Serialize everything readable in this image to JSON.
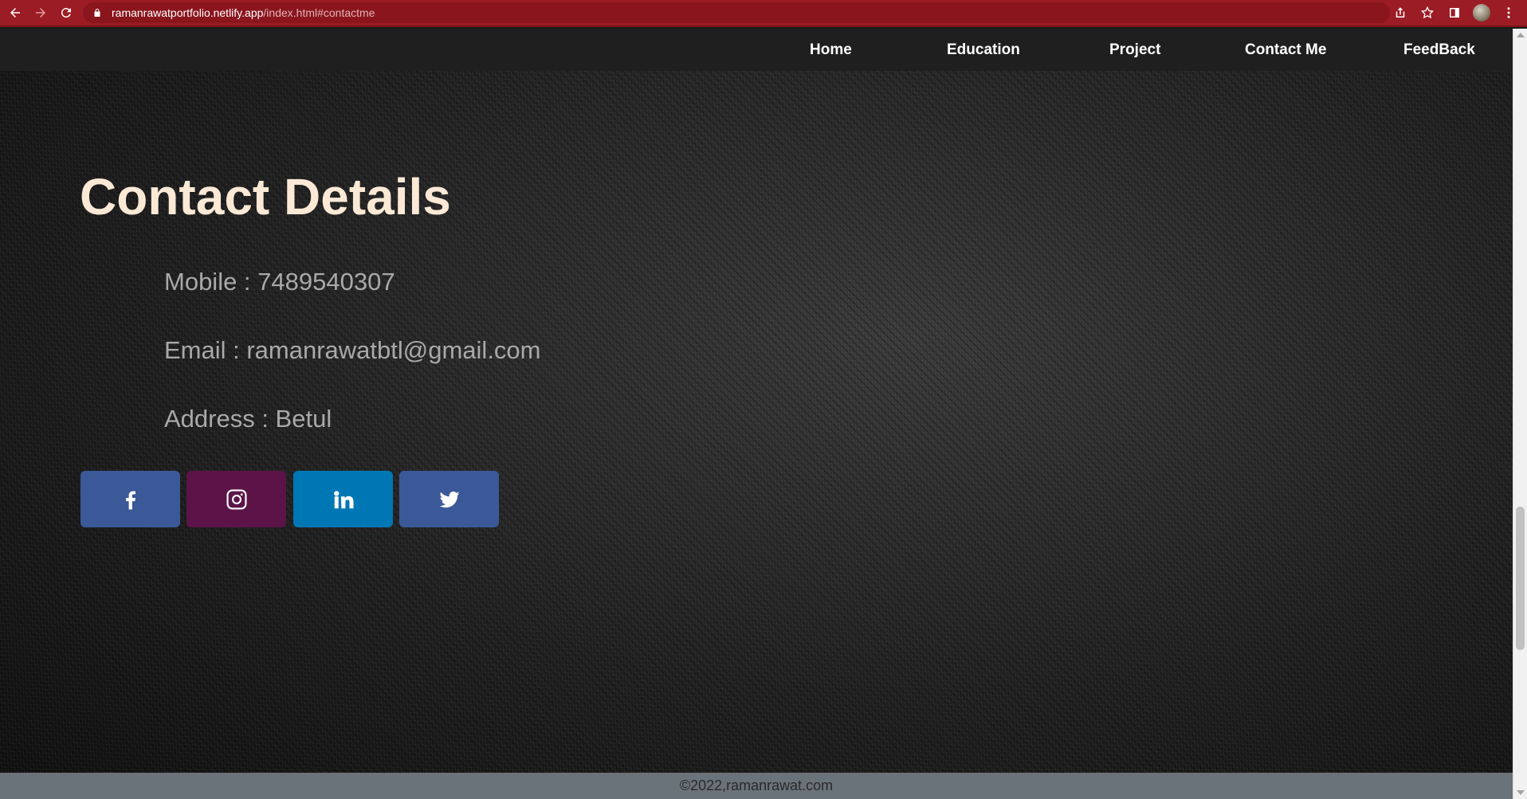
{
  "browser": {
    "url_host": "ramanrawatportfolio.netlify.app",
    "url_path": "/index.html#contactme",
    "icons": [
      "back-icon",
      "forward-icon",
      "reload-icon",
      "lock-icon",
      "share-icon",
      "star-icon",
      "side-panel-icon",
      "profile-avatar",
      "menu-icon"
    ],
    "colors": {
      "frame": "#9b1c24",
      "address_bar": "#8a151d"
    }
  },
  "nav": {
    "items": [
      {
        "label": "Home"
      },
      {
        "label": "Education"
      },
      {
        "label": "Project"
      },
      {
        "label": "Contact Me"
      },
      {
        "label": "FeedBack"
      }
    ]
  },
  "contact": {
    "title": "Contact Details",
    "mobile": "Mobile : 7489540307",
    "email": "Email : ramanrawatbtl@gmail.com",
    "address": "Address : Betul"
  },
  "social": [
    {
      "name": "facebook",
      "icon": "facebook-icon",
      "color": "#3b5998"
    },
    {
      "name": "instagram",
      "icon": "instagram-icon",
      "color": "#5c1448"
    },
    {
      "name": "linkedin",
      "icon": "linkedin-icon",
      "color": "#0077b5"
    },
    {
      "name": "twitter",
      "icon": "twitter-icon",
      "color": "#3b5998"
    }
  ],
  "footer": {
    "text": "©2022,ramanrawat.com"
  },
  "colors": {
    "navbar": "#1f1f1f",
    "heading": "#fbe9d6",
    "contact_text": "#a9a9a9",
    "footer": "#6a727a"
  }
}
